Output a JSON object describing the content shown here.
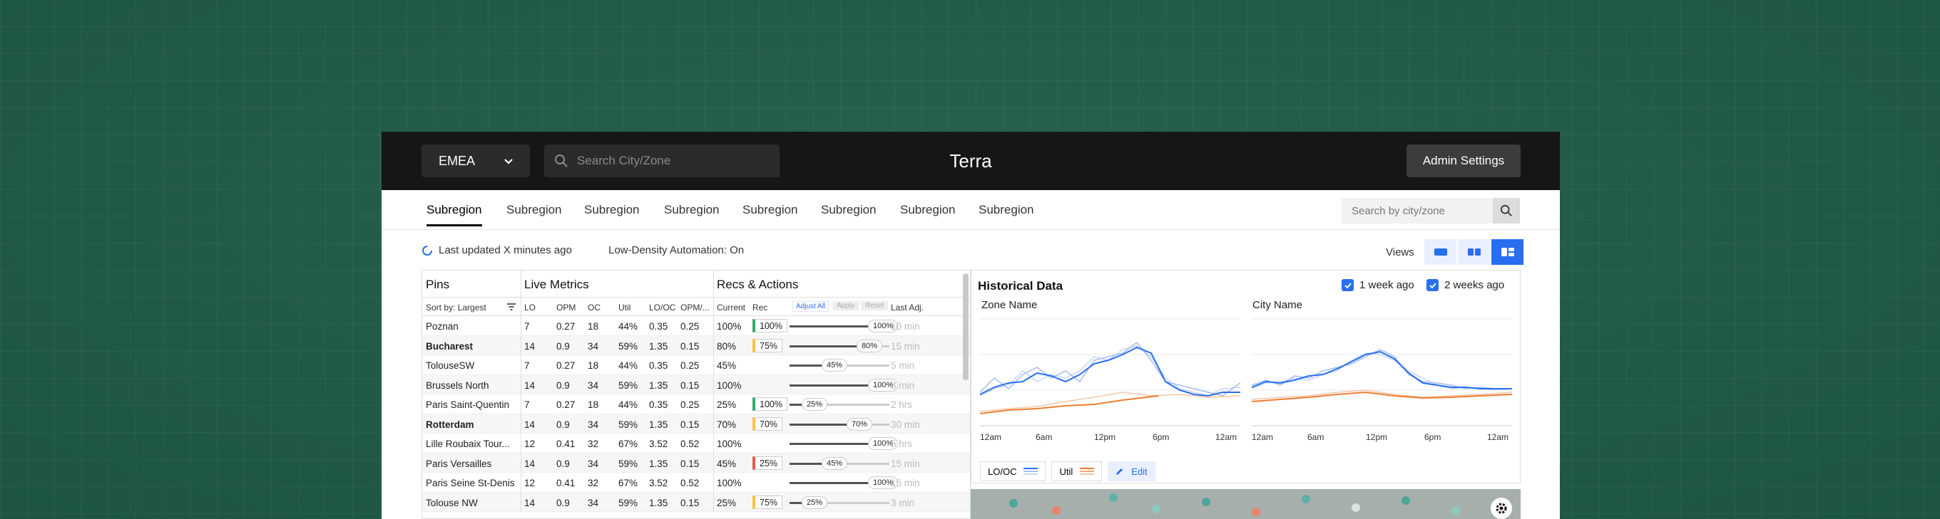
{
  "topbar": {
    "region": "EMEA",
    "search_placeholder": "Search City/Zone",
    "title": "Terra",
    "admin_label": "Admin Settings"
  },
  "tabs": [
    "Subregion",
    "Subregion",
    "Subregion",
    "Subregion",
    "Subregion",
    "Subregion",
    "Subregion",
    "Subregion"
  ],
  "tab_search_placeholder": "Search by city/zone",
  "status": {
    "updated": "Last updated X minutes ago",
    "automation": "Low-Density Automation: On",
    "views_label": "Views"
  },
  "table": {
    "groups": {
      "pins": "Pins",
      "live": "Live Metrics",
      "recs": "Recs & Actions"
    },
    "sort_label": "Sort by: Largest",
    "columns": [
      "LO",
      "OPM",
      "OC",
      "Util",
      "LO/OC",
      "OPM/...",
      "Current",
      "Rec",
      "Last Adj."
    ],
    "buttons": {
      "adjust": "Adjust All",
      "apply": "Apply",
      "reset": "Reset"
    },
    "rows": [
      {
        "name": "Poznan",
        "bold": false,
        "lo": "7",
        "opm": "0.27",
        "oc": "18",
        "util": "44%",
        "looc": "0.35",
        "opmx": "0.25",
        "current": "100%",
        "rec": "100%",
        "rec_color": "#3aa76d",
        "slider": "100%",
        "fill": 1.0,
        "last": "10 min"
      },
      {
        "name": "Bucharest",
        "bold": true,
        "lo": "14",
        "opm": "0.9",
        "oc": "34",
        "util": "59%",
        "looc": "1.35",
        "opmx": "0.15",
        "current": "80%",
        "rec": "75%",
        "rec_color": "#ffc043",
        "slider": "80%",
        "fill": 0.8,
        "last": "15 min"
      },
      {
        "name": "TolouseSW",
        "bold": false,
        "lo": "7",
        "opm": "0.27",
        "oc": "18",
        "util": "44%",
        "looc": "0.35",
        "opmx": "0.25",
        "current": "45%",
        "rec": "",
        "rec_color": "",
        "slider": "45%",
        "fill": 0.45,
        "last": "5 min"
      },
      {
        "name": "Brussels North",
        "bold": false,
        "lo": "14",
        "opm": "0.9",
        "oc": "34",
        "util": "59%",
        "looc": "1.35",
        "opmx": "0.15",
        "current": "100%",
        "rec": "",
        "rec_color": "",
        "slider": "100%",
        "fill": 1.0,
        "last": "3 min"
      },
      {
        "name": "Paris Saint-Quentin",
        "bold": false,
        "lo": "7",
        "opm": "0.27",
        "oc": "18",
        "util": "44%",
        "looc": "0.35",
        "opmx": "0.25",
        "current": "25%",
        "rec": "100%",
        "rec_color": "#3aa76d",
        "slider": "25%",
        "fill": 0.25,
        "last": "2 hrs"
      },
      {
        "name": "Rotterdam",
        "bold": true,
        "lo": "14",
        "opm": "0.9",
        "oc": "34",
        "util": "59%",
        "looc": "1.35",
        "opmx": "0.15",
        "current": "70%",
        "rec": "70%",
        "rec_color": "#ffc043",
        "slider": "70%",
        "fill": 0.7,
        "last": "30 min"
      },
      {
        "name": "Lille Roubaix Tour...",
        "bold": false,
        "lo": "12",
        "opm": "0.41",
        "oc": "32",
        "util": "67%",
        "looc": "3.52",
        "opmx": "0.52",
        "current": "100%",
        "rec": "",
        "rec_color": "",
        "slider": "100%",
        "fill": 1.0,
        "last": "5 hrs"
      },
      {
        "name": "Paris Versailles",
        "bold": false,
        "lo": "14",
        "opm": "0.9",
        "oc": "34",
        "util": "59%",
        "looc": "1.35",
        "opmx": "0.15",
        "current": "45%",
        "rec": "25%",
        "rec_color": "#e85c4a",
        "slider": "45%",
        "fill": 0.45,
        "last": "15 min"
      },
      {
        "name": "Paris Seine St-Denis",
        "bold": false,
        "lo": "12",
        "opm": "0.41",
        "oc": "32",
        "util": "67%",
        "looc": "3.52",
        "opmx": "0.52",
        "current": "100%",
        "rec": "",
        "rec_color": "",
        "slider": "100%",
        "fill": 1.0,
        "last": "15 min"
      },
      {
        "name": "Tolouse NW",
        "bold": false,
        "lo": "14",
        "opm": "0.9",
        "oc": "34",
        "util": "59%",
        "looc": "1.35",
        "opmx": "0.15",
        "current": "25%",
        "rec": "75%",
        "rec_color": "#ffc043",
        "slider": "25%",
        "fill": 0.25,
        "last": "3 min"
      }
    ]
  },
  "history": {
    "title": "Historical Data",
    "check1": "1 week ago",
    "check2": "2 weeks ago",
    "zone_label": "Zone Name",
    "city_label": "City Name",
    "x_ticks": [
      "12am",
      "6am",
      "12pm",
      "6pm",
      "12am"
    ],
    "legend_looc": "LO/OC",
    "legend_util": "Util",
    "edit_label": "Edit"
  }
}
